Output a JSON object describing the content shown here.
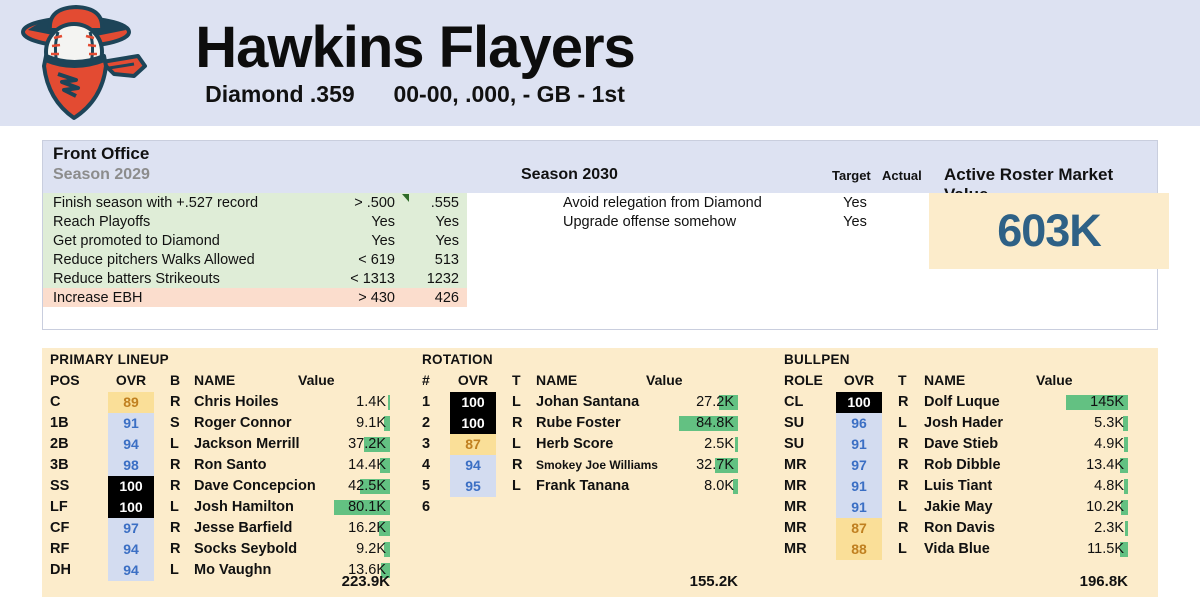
{
  "header": {
    "team_name": "Hawkins Flayers",
    "league": "Diamond .359",
    "record": "00-00, .000, - GB - 1st",
    "logo_icon": "cowboy-bandit-baseball-logo",
    "band_color": "#dde2f2"
  },
  "front_office": {
    "title": "Front Office",
    "season_old": "Season 2029",
    "season_new": "Season 2030",
    "target_header": "Target",
    "actual_header": "Actual",
    "goals_2029": [
      {
        "label": "Finish season with +.527 record",
        "target": "> .500",
        "actual": ".555",
        "status": "ok",
        "flag": true
      },
      {
        "label": "Reach Playoffs",
        "target": "Yes",
        "actual": "Yes",
        "status": "ok",
        "flag": false
      },
      {
        "label": "Get promoted to Diamond",
        "target": "Yes",
        "actual": "Yes",
        "status": "ok",
        "flag": false
      },
      {
        "label": "Reduce pitchers Walks Allowed",
        "target": "< 619",
        "actual": "513",
        "status": "ok",
        "flag": false
      },
      {
        "label": "Reduce batters Strikeouts",
        "target": "< 1313",
        "actual": "1232",
        "status": "ok",
        "flag": false
      },
      {
        "label": "Increase EBH",
        "target": "> 430",
        "actual": "426",
        "status": "bad",
        "flag": false
      }
    ],
    "goals_2030": [
      {
        "label": "Avoid relegation from Diamond",
        "target": "Yes",
        "actual": ""
      },
      {
        "label": "Upgrade offense somehow",
        "target": "Yes",
        "actual": ""
      }
    ],
    "market_value": {
      "title": "Active Roster Market Value",
      "value": "603K",
      "box_color": "#fceccb",
      "text_color": "#2e6186"
    }
  },
  "roster": {
    "background_color": "#fceccb",
    "bar_color": "#63c182",
    "lineup": {
      "title": "PRIMARY LINEUP",
      "columns": [
        "POS",
        "OVR",
        "B",
        "NAME",
        "Value"
      ],
      "total": "223.9K",
      "rows": [
        {
          "pos": "C",
          "ovr": "89",
          "ovr_style": "ovr-yellow",
          "hand": "R",
          "name": "Chris Hoiles",
          "value": "1.4K",
          "bar": 2
        },
        {
          "pos": "1B",
          "ovr": "91",
          "ovr_style": "ovr-blue",
          "hand": "S",
          "name": "Roger Connor",
          "value": "9.1K",
          "bar": 6
        },
        {
          "pos": "2B",
          "ovr": "94",
          "ovr_style": "ovr-blue",
          "hand": "L",
          "name": "Jackson Merrill",
          "value": "37.2K",
          "bar": 26
        },
        {
          "pos": "3B",
          "ovr": "98",
          "ovr_style": "ovr-blue",
          "hand": "R",
          "name": "Ron Santo",
          "value": "14.4K",
          "bar": 10
        },
        {
          "pos": "SS",
          "ovr": "100",
          "ovr_style": "ovr-black",
          "hand": "R",
          "name": "Dave Concepcion",
          "value": "42.5K",
          "bar": 30
        },
        {
          "pos": "LF",
          "ovr": "100",
          "ovr_style": "ovr-black",
          "hand": "L",
          "name": "Josh Hamilton",
          "value": "80.1K",
          "bar": 56
        },
        {
          "pos": "CF",
          "ovr": "97",
          "ovr_style": "ovr-blue",
          "hand": "R",
          "name": "Jesse Barfield",
          "value": "16.2K",
          "bar": 11
        },
        {
          "pos": "RF",
          "ovr": "94",
          "ovr_style": "ovr-blue",
          "hand": "R",
          "name": "Socks Seybold",
          "value": "9.2K",
          "bar": 6
        },
        {
          "pos": "DH",
          "ovr": "94",
          "ovr_style": "ovr-blue",
          "hand": "L",
          "name": "Mo Vaughn",
          "value": "13.6K",
          "bar": 9
        }
      ]
    },
    "rotation": {
      "title": "ROTATION",
      "columns": [
        "#",
        "OVR",
        "T",
        "NAME",
        "Value"
      ],
      "total": "155.2K",
      "rows": [
        {
          "pos": "1",
          "ovr": "100",
          "ovr_style": "ovr-black",
          "hand": "L",
          "name": "Johan Santana",
          "value": "27.2K",
          "bar": 19
        },
        {
          "pos": "2",
          "ovr": "100",
          "ovr_style": "ovr-black",
          "hand": "R",
          "name": "Rube Foster",
          "value": "84.8K",
          "bar": 59
        },
        {
          "pos": "3",
          "ovr": "87",
          "ovr_style": "ovr-yellow",
          "hand": "L",
          "name": "Herb Score",
          "value": "2.5K",
          "bar": 3
        },
        {
          "pos": "4",
          "ovr": "94",
          "ovr_style": "ovr-blue",
          "hand": "R",
          "name": "Smokey Joe Williams",
          "value": "32.7K",
          "bar": 23,
          "small": true
        },
        {
          "pos": "5",
          "ovr": "95",
          "ovr_style": "ovr-blue",
          "hand": "L",
          "name": "Frank Tanana",
          "value": "8.0K",
          "bar": 5
        },
        {
          "pos": "6",
          "ovr": "",
          "ovr_style": "ovr-none",
          "hand": "",
          "name": "",
          "value": "",
          "bar": 0
        }
      ]
    },
    "bullpen": {
      "title": "BULLPEN",
      "columns": [
        "ROLE",
        "OVR",
        "T",
        "NAME",
        "Value"
      ],
      "total": "196.8K",
      "rows": [
        {
          "pos": "CL",
          "ovr": "100",
          "ovr_style": "ovr-black",
          "hand": "R",
          "name": "Dolf Luque",
          "value": "145K",
          "bar": 62
        },
        {
          "pos": "SU",
          "ovr": "96",
          "ovr_style": "ovr-blue",
          "hand": "L",
          "name": "Josh Hader",
          "value": "5.3K",
          "bar": 5
        },
        {
          "pos": "SU",
          "ovr": "91",
          "ovr_style": "ovr-blue",
          "hand": "R",
          "name": "Dave Stieb",
          "value": "4.9K",
          "bar": 4
        },
        {
          "pos": "MR",
          "ovr": "97",
          "ovr_style": "ovr-blue",
          "hand": "R",
          "name": "Rob Dibble",
          "value": "13.4K",
          "bar": 8
        },
        {
          "pos": "MR",
          "ovr": "91",
          "ovr_style": "ovr-blue",
          "hand": "R",
          "name": "Luis Tiant",
          "value": "4.8K",
          "bar": 4
        },
        {
          "pos": "MR",
          "ovr": "91",
          "ovr_style": "ovr-blue",
          "hand": "L",
          "name": "Jakie May",
          "value": "10.2K",
          "bar": 7
        },
        {
          "pos": "MR",
          "ovr": "87",
          "ovr_style": "ovr-yellow",
          "hand": "R",
          "name": "Ron Davis",
          "value": "2.3K",
          "bar": 3
        },
        {
          "pos": "MR",
          "ovr": "88",
          "ovr_style": "ovr-yellow",
          "hand": "L",
          "name": "Vida Blue",
          "value": "11.5K",
          "bar": 8
        }
      ]
    }
  }
}
